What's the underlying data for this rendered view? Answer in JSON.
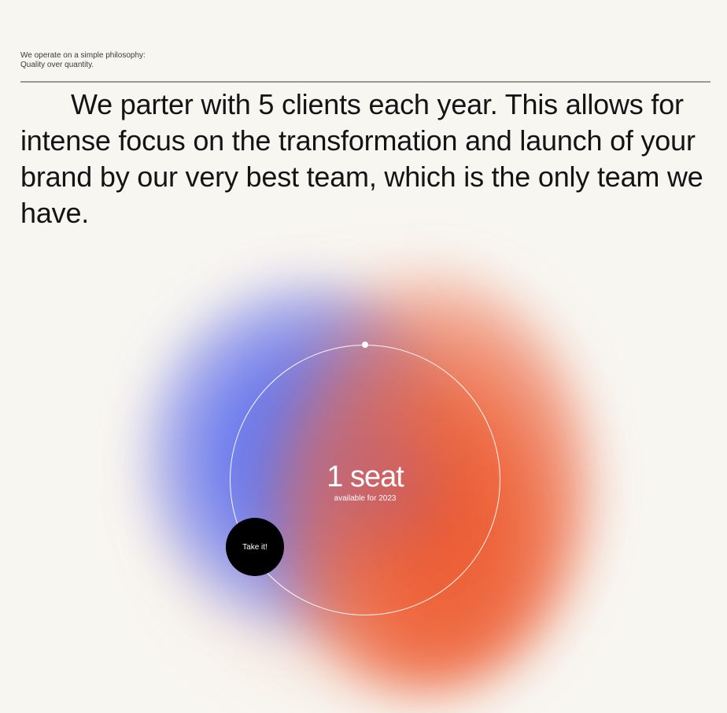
{
  "intro": {
    "line1": "We operate on a simple philosophy:",
    "line2": "Quality over quantity."
  },
  "statement": {
    "text": "We parter with 5 clients each year. This allows for intense focus on the transformation and launch of your brand by our very best team, which is the only team we have."
  },
  "offer": {
    "count": "1",
    "unit": "seat",
    "subtitle": "available for 2023",
    "cta_label": "Take it!"
  },
  "colors": {
    "background": "#f8f6f1",
    "blue": "#6478ee",
    "orange": "#ec5a30",
    "button": "#000000"
  }
}
